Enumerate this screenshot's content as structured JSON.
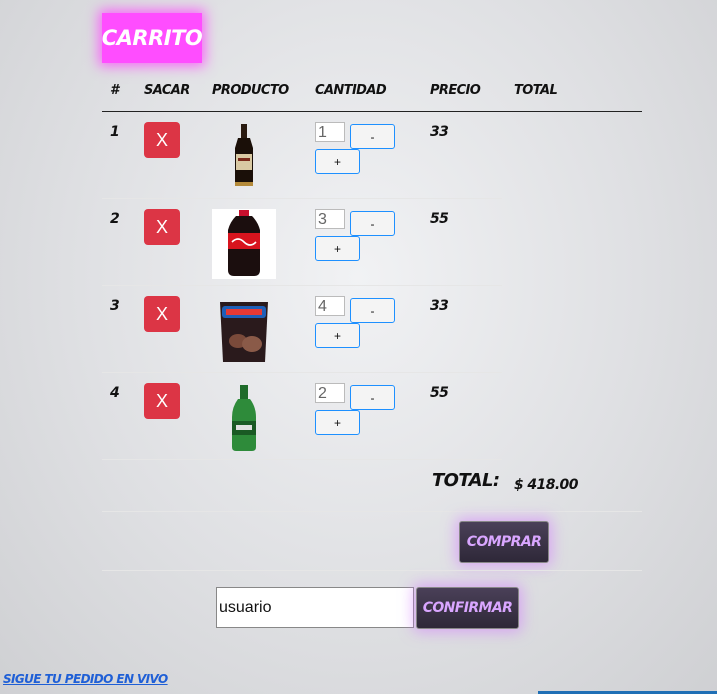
{
  "title": "CARRITO",
  "table": {
    "headers": [
      "#",
      "SACAR",
      "PRODUCTO",
      "CANTIDAD",
      "PRECIO",
      "TOTAL"
    ],
    "rows": [
      {
        "num": "1",
        "remove_label": "X",
        "product_image": "liquor-bottle",
        "quantity": "1",
        "minus_label": "-",
        "plus_label": "+",
        "price": "33"
      },
      {
        "num": "2",
        "remove_label": "X",
        "product_image": "coca-cola-bottle",
        "quantity": "3",
        "minus_label": "-",
        "plus_label": "+",
        "price": "55"
      },
      {
        "num": "3",
        "remove_label": "X",
        "product_image": "chips-bag",
        "quantity": "4",
        "minus_label": "-",
        "plus_label": "+",
        "price": "33"
      },
      {
        "num": "4",
        "remove_label": "X",
        "product_image": "beer-bottle",
        "quantity": "2",
        "minus_label": "-",
        "plus_label": "+",
        "price": "55"
      }
    ]
  },
  "summary": {
    "total_label": "TOTAL:",
    "total_value": "$ 418.00"
  },
  "buy_button": "COMPRAR",
  "user_input_value": "usuario",
  "confirm_button": "CONFIRMAR",
  "live_link": "SIGUE TU PEDIDO EN VIVO",
  "colors": {
    "title_bg": "#ff4dff",
    "remove_button": "#dc3545",
    "qty_button_border": "#1e90ff",
    "dark_button_text": "#d9a6ff",
    "link": "#1f5fd6"
  }
}
